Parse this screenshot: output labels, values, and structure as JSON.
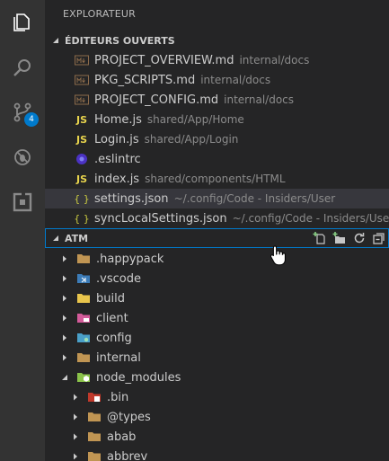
{
  "sidebar": {
    "title": "EXPLORATEUR"
  },
  "activity": {
    "items": [
      {
        "name": "explorer-icon"
      },
      {
        "name": "search-icon"
      },
      {
        "name": "source-control-icon"
      },
      {
        "name": "debug-icon"
      },
      {
        "name": "extensions-icon"
      }
    ],
    "badge": "4"
  },
  "open_editors": {
    "header": "ÉDITEURS OUVERTS",
    "items": [
      {
        "icon": "markdown-icon",
        "name": "PROJECT_OVERVIEW.md",
        "desc": "internal/docs"
      },
      {
        "icon": "markdown-icon",
        "name": "PKG_SCRIPTS.md",
        "desc": "internal/docs"
      },
      {
        "icon": "markdown-icon",
        "name": "PROJECT_CONFIG.md",
        "desc": "internal/docs"
      },
      {
        "icon": "js-icon",
        "icon_text": "JS",
        "name": "Home.js",
        "desc": "shared/App/Home"
      },
      {
        "icon": "js-icon",
        "icon_text": "JS",
        "name": "Login.js",
        "desc": "shared/App/Login"
      },
      {
        "icon": "eslint-icon",
        "name": ".eslintrc",
        "desc": ""
      },
      {
        "icon": "js-icon",
        "icon_text": "JS",
        "name": "index.js",
        "desc": "shared/components/HTML"
      },
      {
        "icon": "json-icon",
        "icon_text": "{ }",
        "name": "settings.json",
        "desc": "~/.config/Code - Insiders/User",
        "selected": true
      },
      {
        "icon": "json-icon",
        "icon_text": "{ }",
        "name": "syncLocalSettings.json",
        "desc": "~/.config/Code - Insiders/User"
      }
    ]
  },
  "atm": {
    "header": "ATM",
    "actions": [
      {
        "name": "new-file-icon"
      },
      {
        "name": "new-folder-icon"
      },
      {
        "name": "refresh-icon"
      },
      {
        "name": "collapse-all-icon"
      }
    ],
    "tree": [
      {
        "name": ".happypack",
        "expanded": false,
        "icon": "folder-icon",
        "depth": 0
      },
      {
        "name": ".vscode",
        "expanded": false,
        "icon": "vscode-folder-icon",
        "depth": 0
      },
      {
        "name": "build",
        "expanded": false,
        "icon": "build-folder-icon",
        "depth": 0
      },
      {
        "name": "client",
        "expanded": false,
        "icon": "client-folder-icon",
        "depth": 0
      },
      {
        "name": "config",
        "expanded": false,
        "icon": "config-folder-icon",
        "depth": 0
      },
      {
        "name": "internal",
        "expanded": false,
        "icon": "folder-icon",
        "depth": 0
      },
      {
        "name": "node_modules",
        "expanded": true,
        "icon": "node-modules-folder-icon",
        "depth": 0
      },
      {
        "name": ".bin",
        "expanded": false,
        "icon": "bin-folder-icon",
        "depth": 1
      },
      {
        "name": "@types",
        "expanded": false,
        "icon": "folder-icon",
        "depth": 1
      },
      {
        "name": "abab",
        "expanded": false,
        "icon": "folder-icon",
        "depth": 1
      },
      {
        "name": "abbrev",
        "expanded": false,
        "icon": "folder-icon",
        "depth": 1
      }
    ]
  },
  "colors": {
    "activity_bar": "#333333",
    "sidebar": "#252526",
    "selection": "#37373d",
    "accent": "#007acc",
    "js": "#e8d44d",
    "json": "#cbcb41",
    "folder": "#c09553"
  }
}
